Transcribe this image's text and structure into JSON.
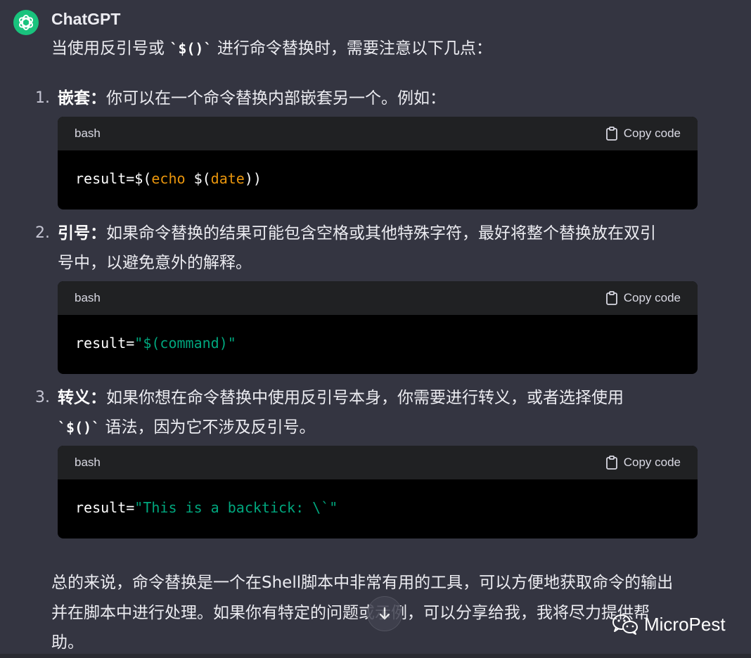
{
  "message": {
    "sender": "ChatGPT",
    "intro": {
      "pre": "当使用反引号或 ",
      "code": "`$()`",
      "post": " 进行命令替换时，需要注意以下几点："
    },
    "items": [
      {
        "number": "1.",
        "title": "嵌套：",
        "line1": "你可以在一个命令替换内部嵌套另一个。例如："
      },
      {
        "number": "2.",
        "title": "引号：",
        "line1": "如果命令替换的结果可能包含空格或其他特殊字符，最好将整个替换放在双引",
        "line2": "号中，以避免意外的解释。"
      },
      {
        "number": "3.",
        "title": "转义：",
        "line1": "如果你想在命令替换中使用反引号本身，你需要进行转义，或者选择使用",
        "line2_code": "`$()`",
        "line2_post": " 语法，因为它不涉及反引号。"
      }
    ],
    "code_blocks": [
      {
        "language": "bash",
        "copy_label": "Copy code",
        "tokens": [
          {
            "text": "result=$(",
            "kind": "plain"
          },
          {
            "text": "echo",
            "kind": "kw"
          },
          {
            "text": " $(",
            "kind": "plain"
          },
          {
            "text": "date",
            "kind": "kw"
          },
          {
            "text": "))",
            "kind": "plain"
          }
        ]
      },
      {
        "language": "bash",
        "copy_label": "Copy code",
        "tokens": [
          {
            "text": "result=",
            "kind": "plain"
          },
          {
            "text": "\"$(command)\"",
            "kind": "str"
          }
        ]
      },
      {
        "language": "bash",
        "copy_label": "Copy code",
        "tokens": [
          {
            "text": "result=",
            "kind": "plain"
          },
          {
            "text": "\"This is a backtick: \\`\"",
            "kind": "str"
          }
        ]
      }
    ],
    "summary": {
      "line1": "总的来说，命令替换是一个在Shell脚本中非常有用的工具，可以方便地获取命令的输出",
      "line2": "并在脚本中进行处理。如果你有特定的问题或示例，可以分享给我，我将尽力提供帮",
      "line3": "助。"
    }
  },
  "icons": {
    "avatar": "openai-logo-icon",
    "copy": "clipboard-icon",
    "scroll": "arrow-down-icon",
    "watermark": "wechat-icon"
  },
  "watermark": {
    "text": "MicroPest"
  },
  "colors": {
    "background": "#343541",
    "code_header": "#202123",
    "code_body": "#000000",
    "keyword": "#e9950c",
    "string": "#00a67d",
    "avatar": "#19c37d"
  }
}
